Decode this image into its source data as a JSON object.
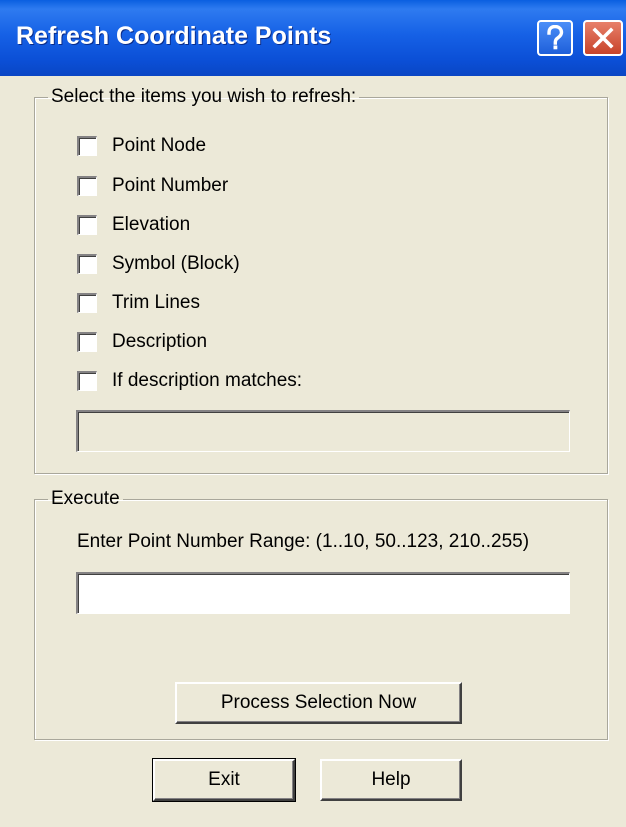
{
  "window": {
    "title": "Refresh Coordinate Points",
    "help_icon": "question-mark-icon",
    "close_icon": "close-x-icon"
  },
  "refresh_group": {
    "legend": "Select the items you wish to refresh:",
    "items": [
      {
        "label": "Point Node",
        "checked": false
      },
      {
        "label": "Point Number",
        "checked": false
      },
      {
        "label": "Elevation",
        "checked": false
      },
      {
        "label": "Symbol (Block)",
        "checked": false
      },
      {
        "label": "Trim Lines",
        "checked": false
      },
      {
        "label": "Description",
        "checked": false
      },
      {
        "label": "If description matches:",
        "checked": false
      }
    ],
    "description_match_value": ""
  },
  "execute_group": {
    "legend": "Execute",
    "range_label": "Enter Point Number Range: (1..10, 50..123, 210..255)",
    "range_value": "",
    "process_button": "Process Selection Now"
  },
  "footer": {
    "exit_button": "Exit",
    "help_button": "Help"
  },
  "colors": {
    "face": "#ECE9D8",
    "titlebar": "#0B4FD6",
    "close_button": "#C8432A"
  }
}
